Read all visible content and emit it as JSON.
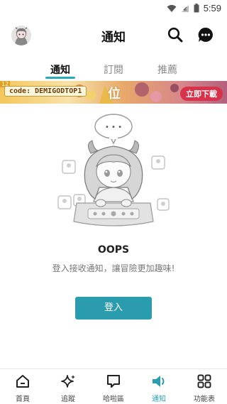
{
  "status_bar": {
    "time": "5:59"
  },
  "header": {
    "title": "通知"
  },
  "tabs": [
    {
      "label": "通知",
      "active": true
    },
    {
      "label": "訂閱",
      "active": false
    },
    {
      "label": "推薦",
      "active": false
    }
  ],
  "banner": {
    "badge": "12",
    "code": "code: DEMIGODTOP1",
    "center_text": "位",
    "cta": "立即下載"
  },
  "empty_state": {
    "bubble": "• • •",
    "title": "OOPS",
    "description": "登入接收通知，讓冒險更加趣味!",
    "login_button": "登入"
  },
  "bottom_nav": [
    {
      "label": "首頁",
      "icon": "home-icon",
      "active": false
    },
    {
      "label": "追蹤",
      "icon": "sparkle-icon",
      "active": false
    },
    {
      "label": "哈啦區",
      "icon": "chat-bubble-icon",
      "active": false
    },
    {
      "label": "通知",
      "icon": "speaker-icon",
      "active": true
    },
    {
      "label": "功能表",
      "icon": "grid-icon",
      "active": false
    }
  ],
  "colors": {
    "accent": "#2a9cad",
    "cta": "#d8324a",
    "text": "#222222"
  }
}
